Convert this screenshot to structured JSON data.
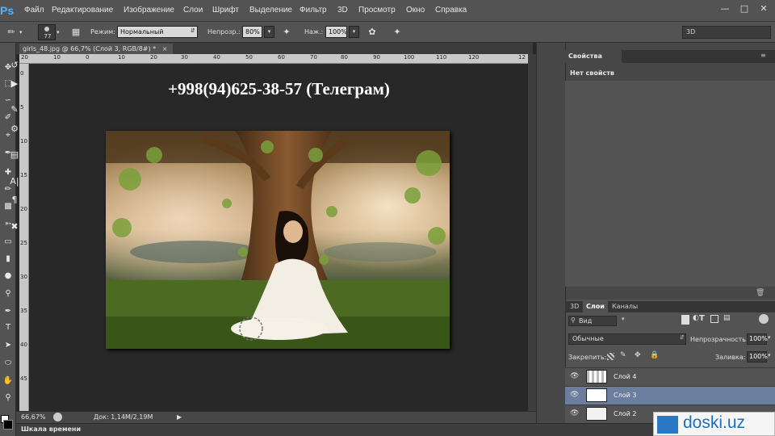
{
  "app": {
    "logo": "Ps",
    "accent": "#4fb3ff"
  },
  "menu": [
    "Файл",
    "Редактирование",
    "Изображение",
    "Слои",
    "Шрифт",
    "Выделение",
    "Фильтр",
    "3D",
    "Просмотр",
    "Окно",
    "Справка"
  ],
  "window_controls": [
    "minimize-icon",
    "maximize-icon",
    "close-icon"
  ],
  "options": {
    "brush_size": "77",
    "mode_label": "Режим:",
    "mode_value": "Нормальный",
    "opacity_label": "Непрозр.:",
    "opacity_value": "80%",
    "pressure_label": "Наж.:",
    "pressure_value": "100%",
    "workspace": "3D"
  },
  "document": {
    "tab_title": "girls_48.jpg @ 66,7% (Слой 3, RGB/8#) *",
    "ruler_h": [
      "20",
      "10",
      "0",
      "10",
      "20",
      "30",
      "40",
      "50",
      "60",
      "70",
      "80",
      "90",
      "100",
      "110",
      "120",
      "12"
    ],
    "ruler_v": [
      "0",
      "5",
      "10",
      "15",
      "20",
      "25",
      "30",
      "35",
      "40",
      "45"
    ],
    "overlay_text": "+998(94)625-38-57 (Телеграм)",
    "zoom": "66,67%",
    "doc_info": "Док: 1,14M/2,19M"
  },
  "timeline": {
    "label": "Шкала времени"
  },
  "properties": {
    "tab": "Свойства",
    "empty": "Нет свойств"
  },
  "layers_panel": {
    "tabs": [
      "3D",
      "Слои",
      "Каналы"
    ],
    "active_tab": "Слои",
    "filter": "Вид",
    "blend_mode": "Обычные",
    "opacity_label": "Непрозрачность:",
    "opacity_value": "100%",
    "lock_label": "Закрепить:",
    "fill_label": "Заливка:",
    "fill_value": "100%",
    "layers": [
      {
        "name": "Слой 4",
        "selected": false
      },
      {
        "name": "Слой 3",
        "selected": true
      },
      {
        "name": "Слой 2",
        "selected": false
      }
    ]
  },
  "watermark": {
    "text": "doski.uz"
  },
  "colors": {
    "selected_layer": "#6b7e9e",
    "ui_dark": "#535353"
  }
}
